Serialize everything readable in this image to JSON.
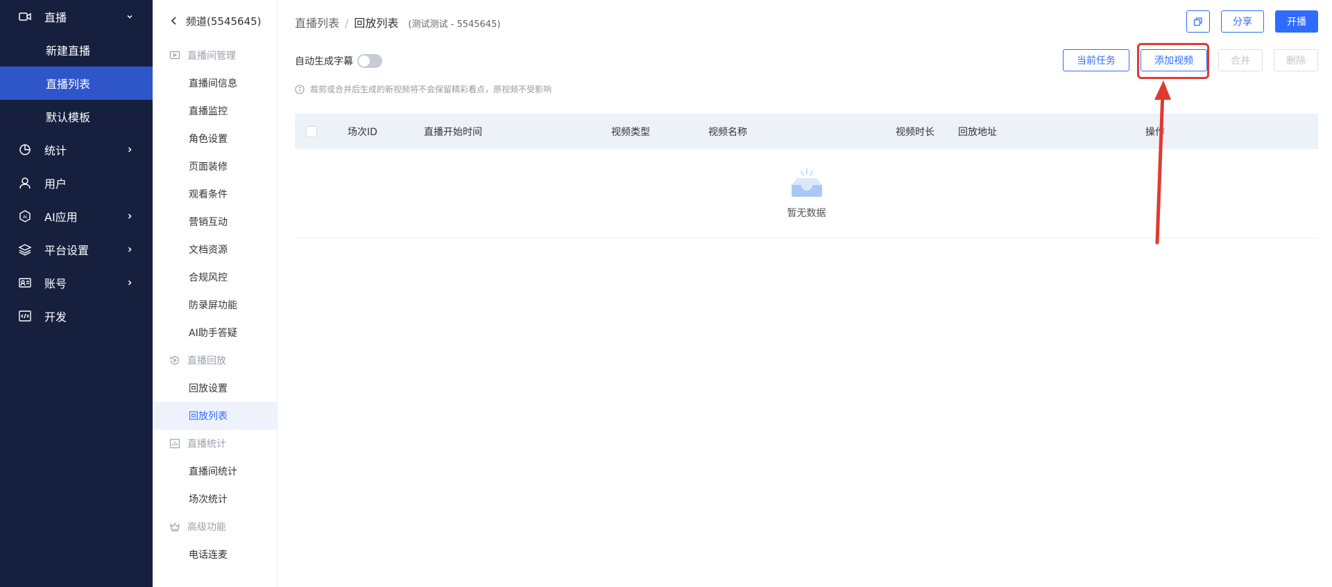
{
  "sidebar": {
    "live": {
      "label": "直播",
      "icon": "video-camera-icon"
    },
    "live_subitems": [
      {
        "label": "新建直播",
        "active": false
      },
      {
        "label": "直播列表",
        "active": true
      },
      {
        "label": "默认模板",
        "active": false
      }
    ],
    "items": [
      {
        "label": "统计",
        "icon": "pie-chart-icon",
        "expandable": true
      },
      {
        "label": "用户",
        "icon": "user-icon",
        "expandable": false
      },
      {
        "label": "AI应用",
        "icon": "ai-hexagon-icon",
        "expandable": true
      },
      {
        "label": "平台设置",
        "icon": "layers-icon",
        "expandable": true
      },
      {
        "label": "账号",
        "icon": "id-card-icon",
        "expandable": true
      },
      {
        "label": "开发",
        "icon": "code-icon",
        "expandable": false
      }
    ]
  },
  "subnav": {
    "back_label": "频道(5545645)",
    "groups": [
      {
        "title": "直播间管理",
        "icon": "play-screen-icon",
        "items": [
          "直播间信息",
          "直播监控",
          "角色设置",
          "页面装修",
          "观看条件",
          "营销互动",
          "文档资源",
          "合规风控",
          "防录屏功能",
          "AI助手答疑"
        ]
      },
      {
        "title": "直播回放",
        "icon": "replay-icon",
        "items": [
          "回放设置",
          "回放列表"
        ]
      },
      {
        "title": "直播统计",
        "icon": "bar-chart-icon",
        "items": [
          "直播间统计",
          "场次统计"
        ]
      },
      {
        "title": "高级功能",
        "icon": "crown-icon",
        "items": [
          "电话连麦"
        ]
      }
    ],
    "active_item": "回放列表"
  },
  "breadcrumb": {
    "parent": "直播列表",
    "separator": "/",
    "current": "回放列表",
    "subtitle": "(测试测试 - 5545645)"
  },
  "top_actions": {
    "copy_icon": "copy-icon",
    "share_label": "分享",
    "start_label": "开播"
  },
  "toggle": {
    "label": "自动生成字幕",
    "enabled": false
  },
  "list_actions": {
    "current_task_label": "当前任务",
    "add_video_label": "添加视频",
    "merge_label": "合并",
    "delete_label": "删除"
  },
  "hint": {
    "text": "裁剪或合并后生成的新视频将不会保留精彩看点，原视频不受影响"
  },
  "table": {
    "columns": [
      "场次ID",
      "直播开始时间",
      "视频类型",
      "视频名称",
      "视频时长",
      "回放地址",
      "操作"
    ],
    "rows": [],
    "empty_text": "暂无数据"
  },
  "colors": {
    "sidebar_bg": "#16203e",
    "active_blue": "#2f56c8",
    "primary": "#2f6bff",
    "annotation_red": "#e03a2f"
  }
}
